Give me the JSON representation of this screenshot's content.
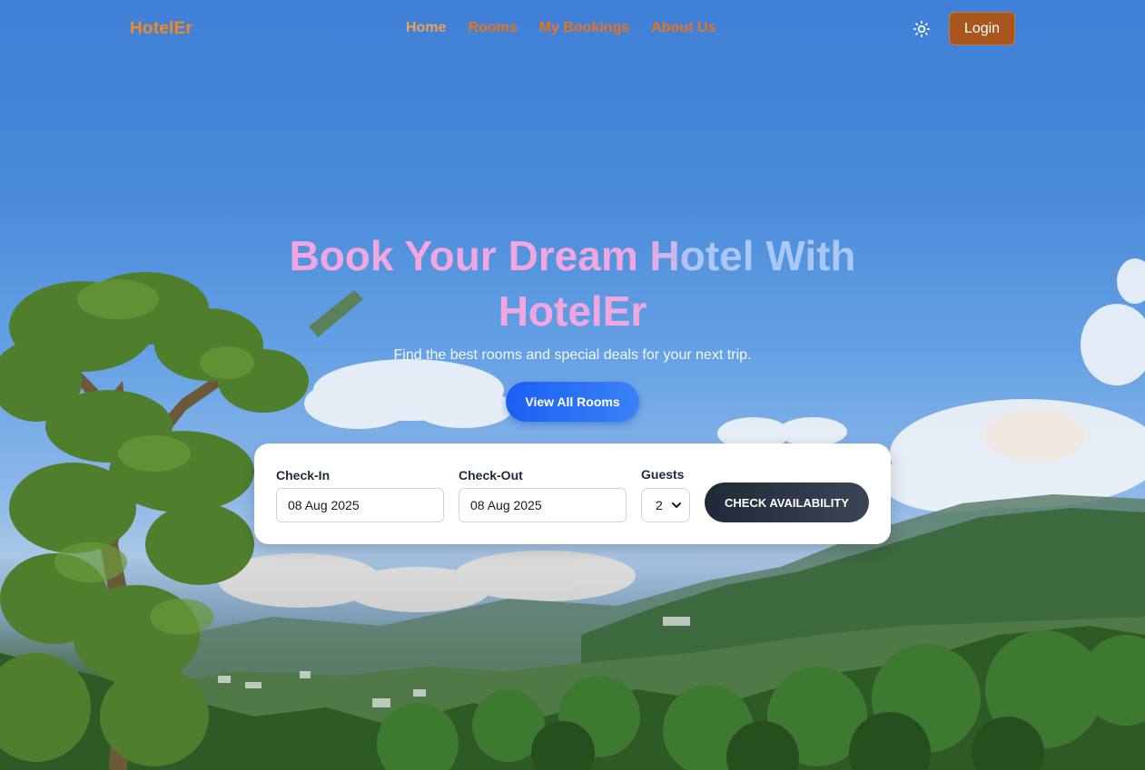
{
  "brand": {
    "name": "HotelEr",
    "accent": "#f28a1f"
  },
  "nav": {
    "items": [
      {
        "label": "Home",
        "active": true
      },
      {
        "label": "Rooms",
        "active": false
      },
      {
        "label": "My Bookings",
        "active": false
      },
      {
        "label": "About Us",
        "active": false
      }
    ],
    "theme_icon": "sun-icon",
    "login_label": "Login"
  },
  "hero": {
    "title_line1": "Book Your Dream Hotel With",
    "title_line2": "HotelEr",
    "subtitle": "Find the best rooms and special deals for your next trip.",
    "cta_label": "View All Rooms"
  },
  "booking": {
    "checkin_label": "Check-In",
    "checkin_value": "08 Aug 2025",
    "checkout_label": "Check-Out",
    "checkout_value": "08 Aug 2025",
    "guests_label": "Guests",
    "guests_value": "2",
    "submit_label": "CHECK AVAILABILITY"
  }
}
